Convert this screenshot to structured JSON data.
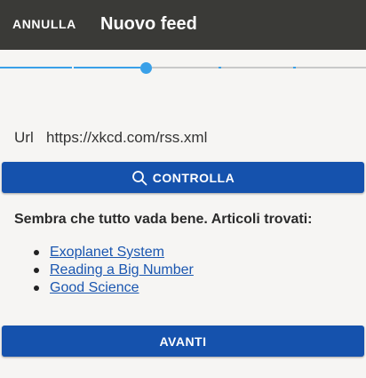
{
  "appbar": {
    "cancel_label": "ANNULLA",
    "title": "Nuovo feed"
  },
  "stepper": {
    "current_step": 3,
    "total_steps": 5
  },
  "form": {
    "url_label": "Url",
    "url_value": "https://xkcd.com/rss.xml"
  },
  "check_button": {
    "label": "CONTROLLA",
    "icon": "search-icon"
  },
  "result": {
    "message": "Sembra che tutto vada bene. Articoli trovati:",
    "articles": [
      "Exoplanet System",
      "Reading a Big Number",
      "Good Science"
    ]
  },
  "next_button": {
    "label": "AVANTI"
  },
  "colors": {
    "appbar": "#3a3a37",
    "primary": "#1552ad",
    "accent": "#3aa0e8",
    "link": "#1a56b0",
    "background": "#f6f5f3"
  }
}
